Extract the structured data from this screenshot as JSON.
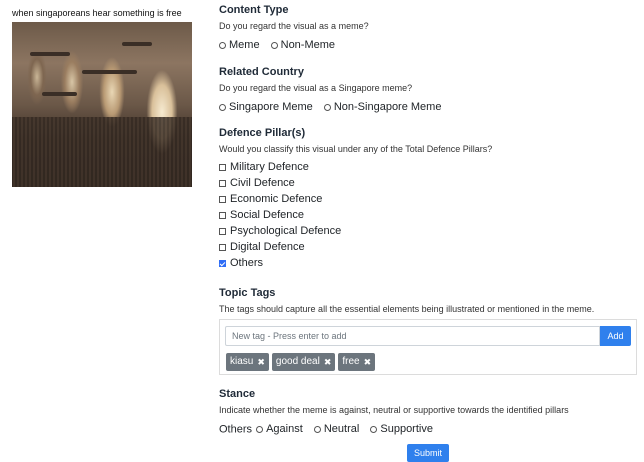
{
  "meme": {
    "caption": "when singaporeans hear something is free"
  },
  "content_type": {
    "title": "Content Type",
    "question": "Do you regard the visual as a meme?",
    "options": [
      "Meme",
      "Non-Meme"
    ]
  },
  "related_country": {
    "title": "Related Country",
    "question": "Do you regard the visual as a Singapore meme?",
    "options": [
      "Singapore Meme",
      "Non-Singapore Meme"
    ]
  },
  "defence_pillars": {
    "title": "Defence Pillar(s)",
    "question": "Would you classify this visual under any of the Total Defence Pillars?",
    "options": [
      {
        "label": "Military Defence",
        "checked": false
      },
      {
        "label": "Civil Defence",
        "checked": false
      },
      {
        "label": "Economic Defence",
        "checked": false
      },
      {
        "label": "Social Defence",
        "checked": false
      },
      {
        "label": "Psychological Defence",
        "checked": false
      },
      {
        "label": "Digital Defence",
        "checked": false
      },
      {
        "label": "Others",
        "checked": true
      }
    ]
  },
  "topic_tags": {
    "title": "Topic Tags",
    "description": "The tags should capture all the essential elements being illustrated or mentioned in the meme.",
    "input_placeholder": "New tag - Press enter to add",
    "add_label": "Add",
    "tags": [
      "kiasu",
      "good deal",
      "free"
    ],
    "remove_glyph": "✖"
  },
  "stance": {
    "title": "Stance",
    "description": "Indicate whether the meme is against, neutral or supportive towards the identified pillars",
    "row_label": "Others",
    "options": [
      "Against",
      "Neutral",
      "Supportive"
    ]
  },
  "submit_label": "Submit",
  "colors": {
    "primary": "#2f80ed",
    "tag_bg": "#6c757d"
  }
}
